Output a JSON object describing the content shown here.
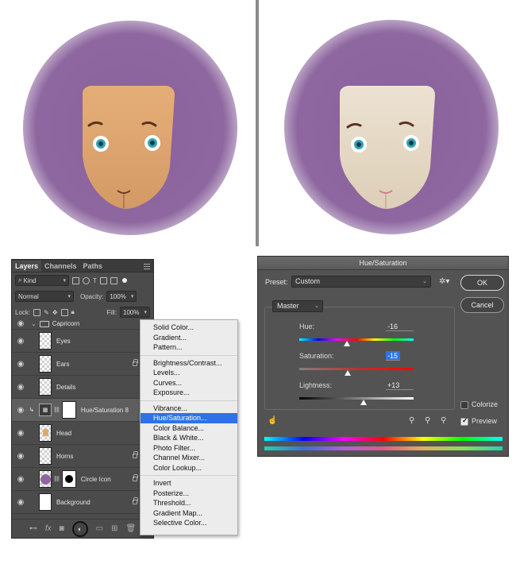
{
  "layers_panel": {
    "tabs": [
      "Layers",
      "Channels",
      "Paths"
    ],
    "kind_label": "Kind",
    "blend_mode": "Normal",
    "opacity_label": "Opacity:",
    "opacity_value": "100%",
    "lock_label": "Lock:",
    "fill_label": "Fill:",
    "fill_value": "100%",
    "group_name": "Capricorn",
    "layers": [
      {
        "name": "Eyes",
        "locked": false
      },
      {
        "name": "Ears",
        "locked": true
      },
      {
        "name": "Details",
        "locked": false
      },
      {
        "name": "Hue/Saturation 8",
        "locked": false
      },
      {
        "name": "Head",
        "locked": false
      },
      {
        "name": "Horns",
        "locked": true
      },
      {
        "name": "Circle Icon",
        "locked": true
      },
      {
        "name": "Background",
        "locked": true
      }
    ]
  },
  "adjustment_menu": {
    "groups": [
      [
        "Solid Color...",
        "Gradient...",
        "Pattern..."
      ],
      [
        "Brightness/Contrast...",
        "Levels...",
        "Curves...",
        "Exposure..."
      ],
      [
        "Vibrance...",
        "Hue/Saturation...",
        "Color Balance...",
        "Black & White...",
        "Photo Filter...",
        "Channel Mixer...",
        "Color Lookup..."
      ],
      [
        "Invert",
        "Posterize...",
        "Threshold...",
        "Gradient Map...",
        "Selective Color..."
      ]
    ],
    "highlighted": "Hue/Saturation..."
  },
  "dialog": {
    "title": "Hue/Saturation",
    "preset_label": "Preset:",
    "preset_value": "Custom",
    "channel": "Master",
    "ok_label": "OK",
    "cancel_label": "Cancel",
    "hue_label": "Hue:",
    "hue_value": "-16",
    "saturation_label": "Saturation:",
    "saturation_value": "-15",
    "lightness_label": "Lightness:",
    "lightness_value": "+13",
    "colorize_label": "Colorize",
    "colorize_checked": false,
    "preview_label": "Preview",
    "preview_checked": true
  },
  "colors": {
    "circle": "#8e67a0",
    "face_original": "#e0a871",
    "face_adjusted": "#e9dcc8",
    "menu_highlight": "#2f72e6"
  }
}
